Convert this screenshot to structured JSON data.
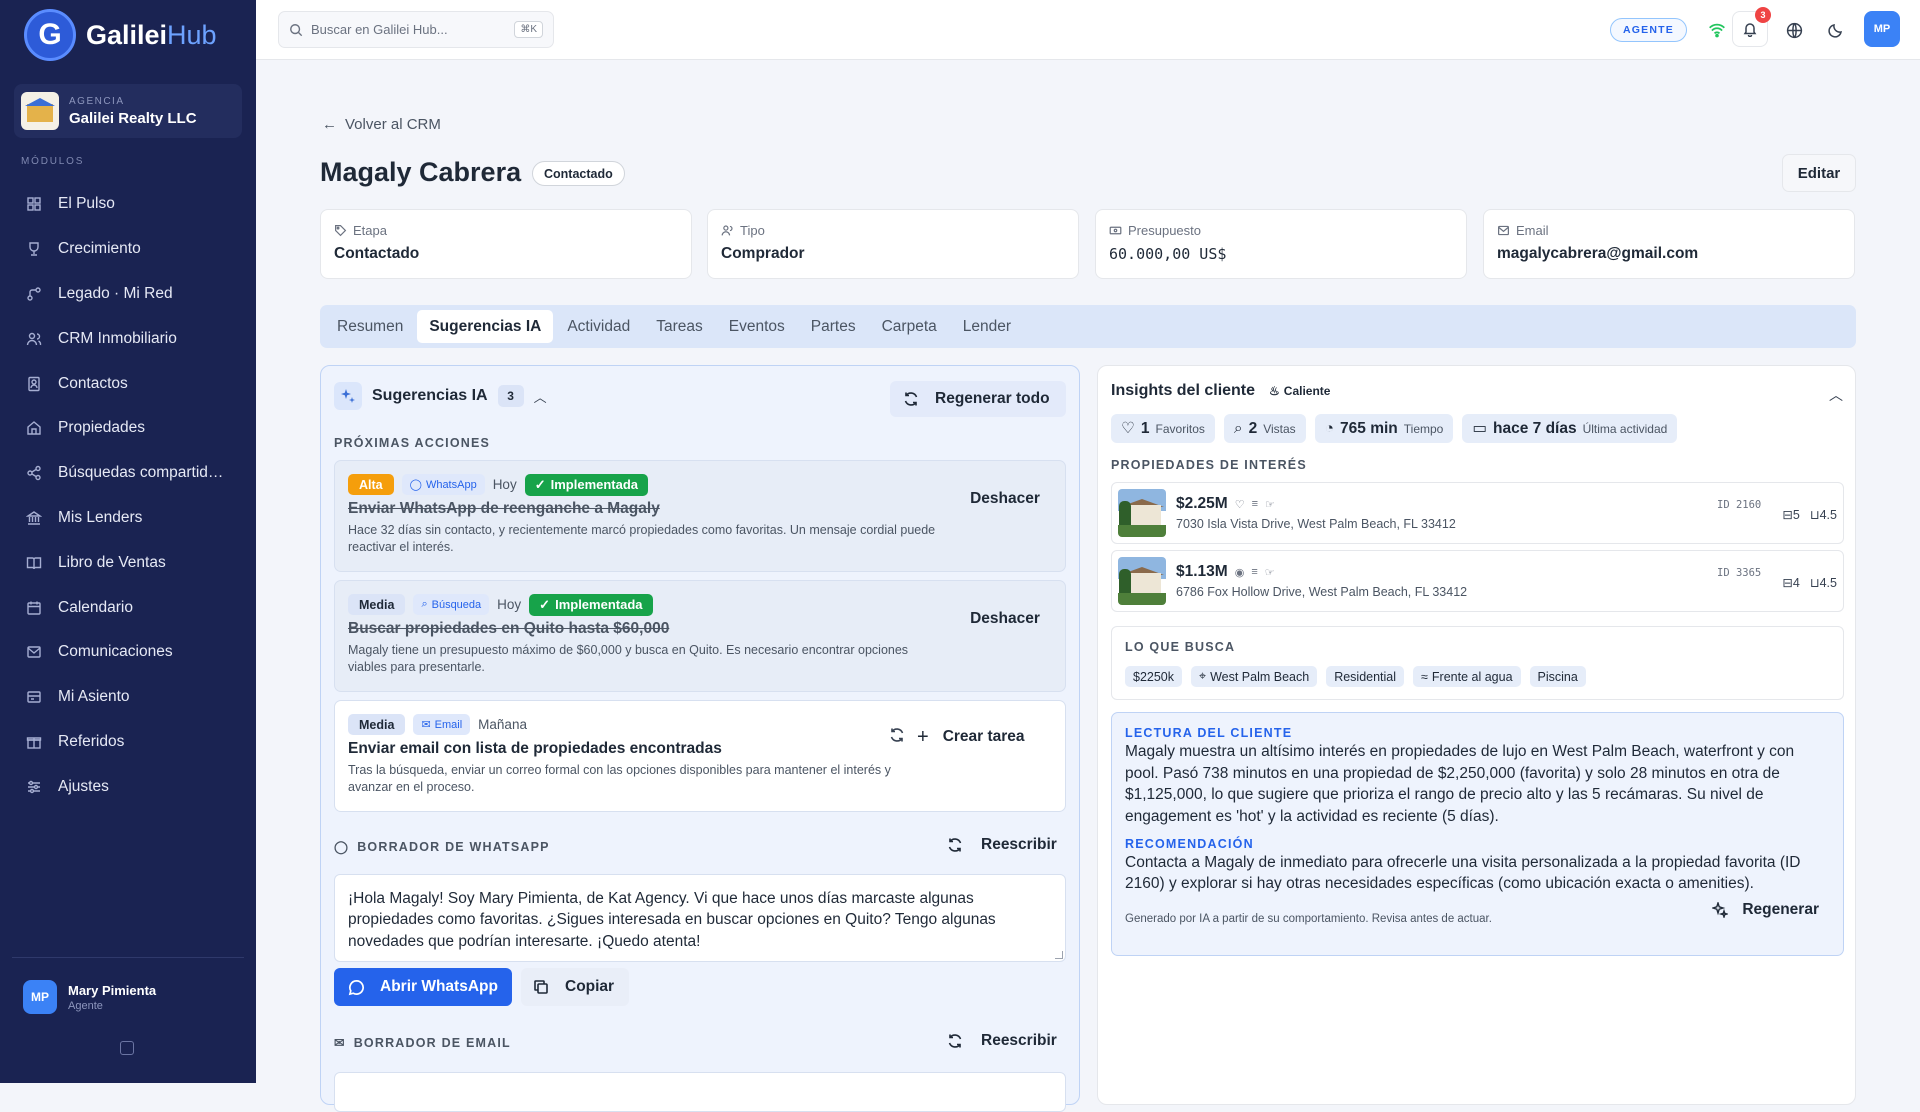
{
  "brand": {
    "name_main": "Galilei",
    "name_accent": "Hub",
    "logo_letter": "G"
  },
  "agency": {
    "label": "AGENCIA",
    "name": "Galilei Realty LLC"
  },
  "sidebar": {
    "modules_label": "MÓDULOS",
    "items": [
      {
        "label": "El Pulso",
        "icon": "grid-icon"
      },
      {
        "label": "Crecimiento",
        "icon": "trophy-icon"
      },
      {
        "label": "Legado · Mi Red",
        "icon": "network-icon"
      },
      {
        "label": "CRM Inmobiliario",
        "icon": "users-icon"
      },
      {
        "label": "Contactos",
        "icon": "contact-card-icon"
      },
      {
        "label": "Propiedades",
        "icon": "home-icon"
      },
      {
        "label": "Búsquedas compartid…",
        "icon": "share-icon"
      },
      {
        "label": "Mis Lenders",
        "icon": "bank-icon"
      },
      {
        "label": "Libro de Ventas",
        "icon": "book-icon"
      },
      {
        "label": "Calendario",
        "icon": "calendar-icon"
      },
      {
        "label": "Comunicaciones",
        "icon": "mail-icon"
      },
      {
        "label": "Mi Asiento",
        "icon": "ledger-icon"
      },
      {
        "label": "Referidos",
        "icon": "gift-icon"
      },
      {
        "label": "Ajustes",
        "icon": "sliders-icon"
      }
    ],
    "user": {
      "initials": "MP",
      "name": "Mary Pimienta",
      "role": "Agente"
    }
  },
  "topbar": {
    "search_placeholder": "Buscar en Galilei Hub...",
    "shortcut": "⌘K",
    "role_badge": "AGENTE",
    "notifications": "3",
    "avatar_initials": "MP"
  },
  "page": {
    "back_label": "Volver al CRM",
    "title": "Magaly Cabrera",
    "status": "Contactado",
    "edit_label": "Editar"
  },
  "info_cards": [
    {
      "label": "Etapa",
      "value": "Contactado",
      "icon": "tag-icon"
    },
    {
      "label": "Tipo",
      "value": "Comprador",
      "icon": "users-icon"
    },
    {
      "label": "Presupuesto",
      "value": "60.000,00 US$",
      "icon": "money-icon"
    },
    {
      "label": "Email",
      "value": "magalycabrera@gmail.com",
      "icon": "mail-icon"
    }
  ],
  "tabs": [
    "Resumen",
    "Sugerencias IA",
    "Actividad",
    "Tareas",
    "Eventos",
    "Partes",
    "Carpeta",
    "Lender"
  ],
  "active_tab": "Sugerencias IA",
  "suggestions": {
    "title": "Sugerencias IA",
    "count": "3",
    "regen_all": "Regenerar todo",
    "next_actions_label": "PRÓXIMAS ACCIONES",
    "actions": [
      {
        "priority": "Alta",
        "channel": "WhatsApp",
        "when": "Hoy",
        "status": "Implementada",
        "title": "Enviar WhatsApp de reenganche a Magaly",
        "desc": "Hace 32 días sin contacto, y recientemente marcó propiedades como favoritas. Un mensaje cordial puede reactivar el interés.",
        "button": "Deshacer"
      },
      {
        "priority": "Media",
        "channel": "Búsqueda",
        "when": "Hoy",
        "status": "Implementada",
        "title": "Buscar propiedades en Quito hasta $60,000",
        "desc": "Magaly tiene un presupuesto máximo de $60,000 y busca en Quito. Es necesario encontrar opciones viables para presentarle.",
        "button": "Deshacer"
      },
      {
        "priority": "Media",
        "channel": "Email",
        "when": "Mañana",
        "title": "Enviar email con lista de propiedades encontradas",
        "desc": "Tras la búsqueda, enviar un correo formal con las opciones disponibles para mantener el interés y avanzar en el proceso.",
        "button": "Crear tarea"
      }
    ],
    "whatsapp_label": "BORRADOR DE WHATSAPP",
    "rewrite_label": "Reescribir",
    "whatsapp_draft": "¡Hola Magaly! Soy Mary Pimienta, de Kat Agency. Vi que hace unos días marcaste algunas propiedades como favoritas. ¿Sigues interesada en buscar opciones en Quito? Tengo algunas novedades que podrían interesarte. ¡Quedo atenta!",
    "open_whatsapp": "Abrir WhatsApp",
    "copy": "Copiar",
    "email_label": "BORRADOR DE EMAIL"
  },
  "insights": {
    "title": "Insights del cliente",
    "temperature": "Caliente",
    "stats": [
      {
        "value": "1",
        "label": "Favoritos",
        "icon": "heart-icon"
      },
      {
        "value": "2",
        "label": "Vistas",
        "icon": "search-icon"
      },
      {
        "value": "765 min",
        "label": "Tiempo",
        "icon": "timer-icon"
      },
      {
        "value": "hace 7 días",
        "label": "Última actividad",
        "icon": "calendar-icon"
      }
    ],
    "properties_label": "PROPIEDADES DE INTERÉS",
    "properties": [
      {
        "price": "$2.25M",
        "address": "7030 Isla Vista Drive, West Palm Beach, FL 33412",
        "id": "ID 2160",
        "beds": "5",
        "baths": "4.5"
      },
      {
        "price": "$1.13M",
        "address": "6786 Fox Hollow Drive, West Palm Beach, FL 33412",
        "id": "ID 3365",
        "beds": "4",
        "baths": "4.5"
      }
    ],
    "wants_label": "LO QUE BUSCA",
    "wants": [
      "$2250k",
      "West Palm Beach",
      "Residential",
      "Frente al agua",
      "Piscina"
    ],
    "reading_label": "LECTURA DEL CLIENTE",
    "reading": "Magaly muestra un altísimo interés en propiedades de lujo en West Palm Beach, waterfront y con pool. Pasó 738 minutos en una propiedad de $2,250,000 (favorita) y solo 28 minutos en otra de $1,125,000, lo que sugiere que prioriza el rango de precio alto y las 5 recámaras. Su nivel de engagement es 'hot' y la actividad es reciente (5 días).",
    "recommendation_label": "RECOMENDACIÓN",
    "recommendation": "Contacta a Magaly de inmediato para ofrecerle una visita personalizada a la propiedad favorita (ID 2160) y explorar si hay otras necesidades específicas (como ubicación exacta o amenities).",
    "footer": "Generado por IA a partir de su comportamiento. Revisa antes de actuar.",
    "regen": "Regenerar"
  },
  "colors": {
    "sidebar": "#1a2352",
    "accent": "#2563eb",
    "success": "#17a34a",
    "priority_high": "#f59e0b"
  }
}
